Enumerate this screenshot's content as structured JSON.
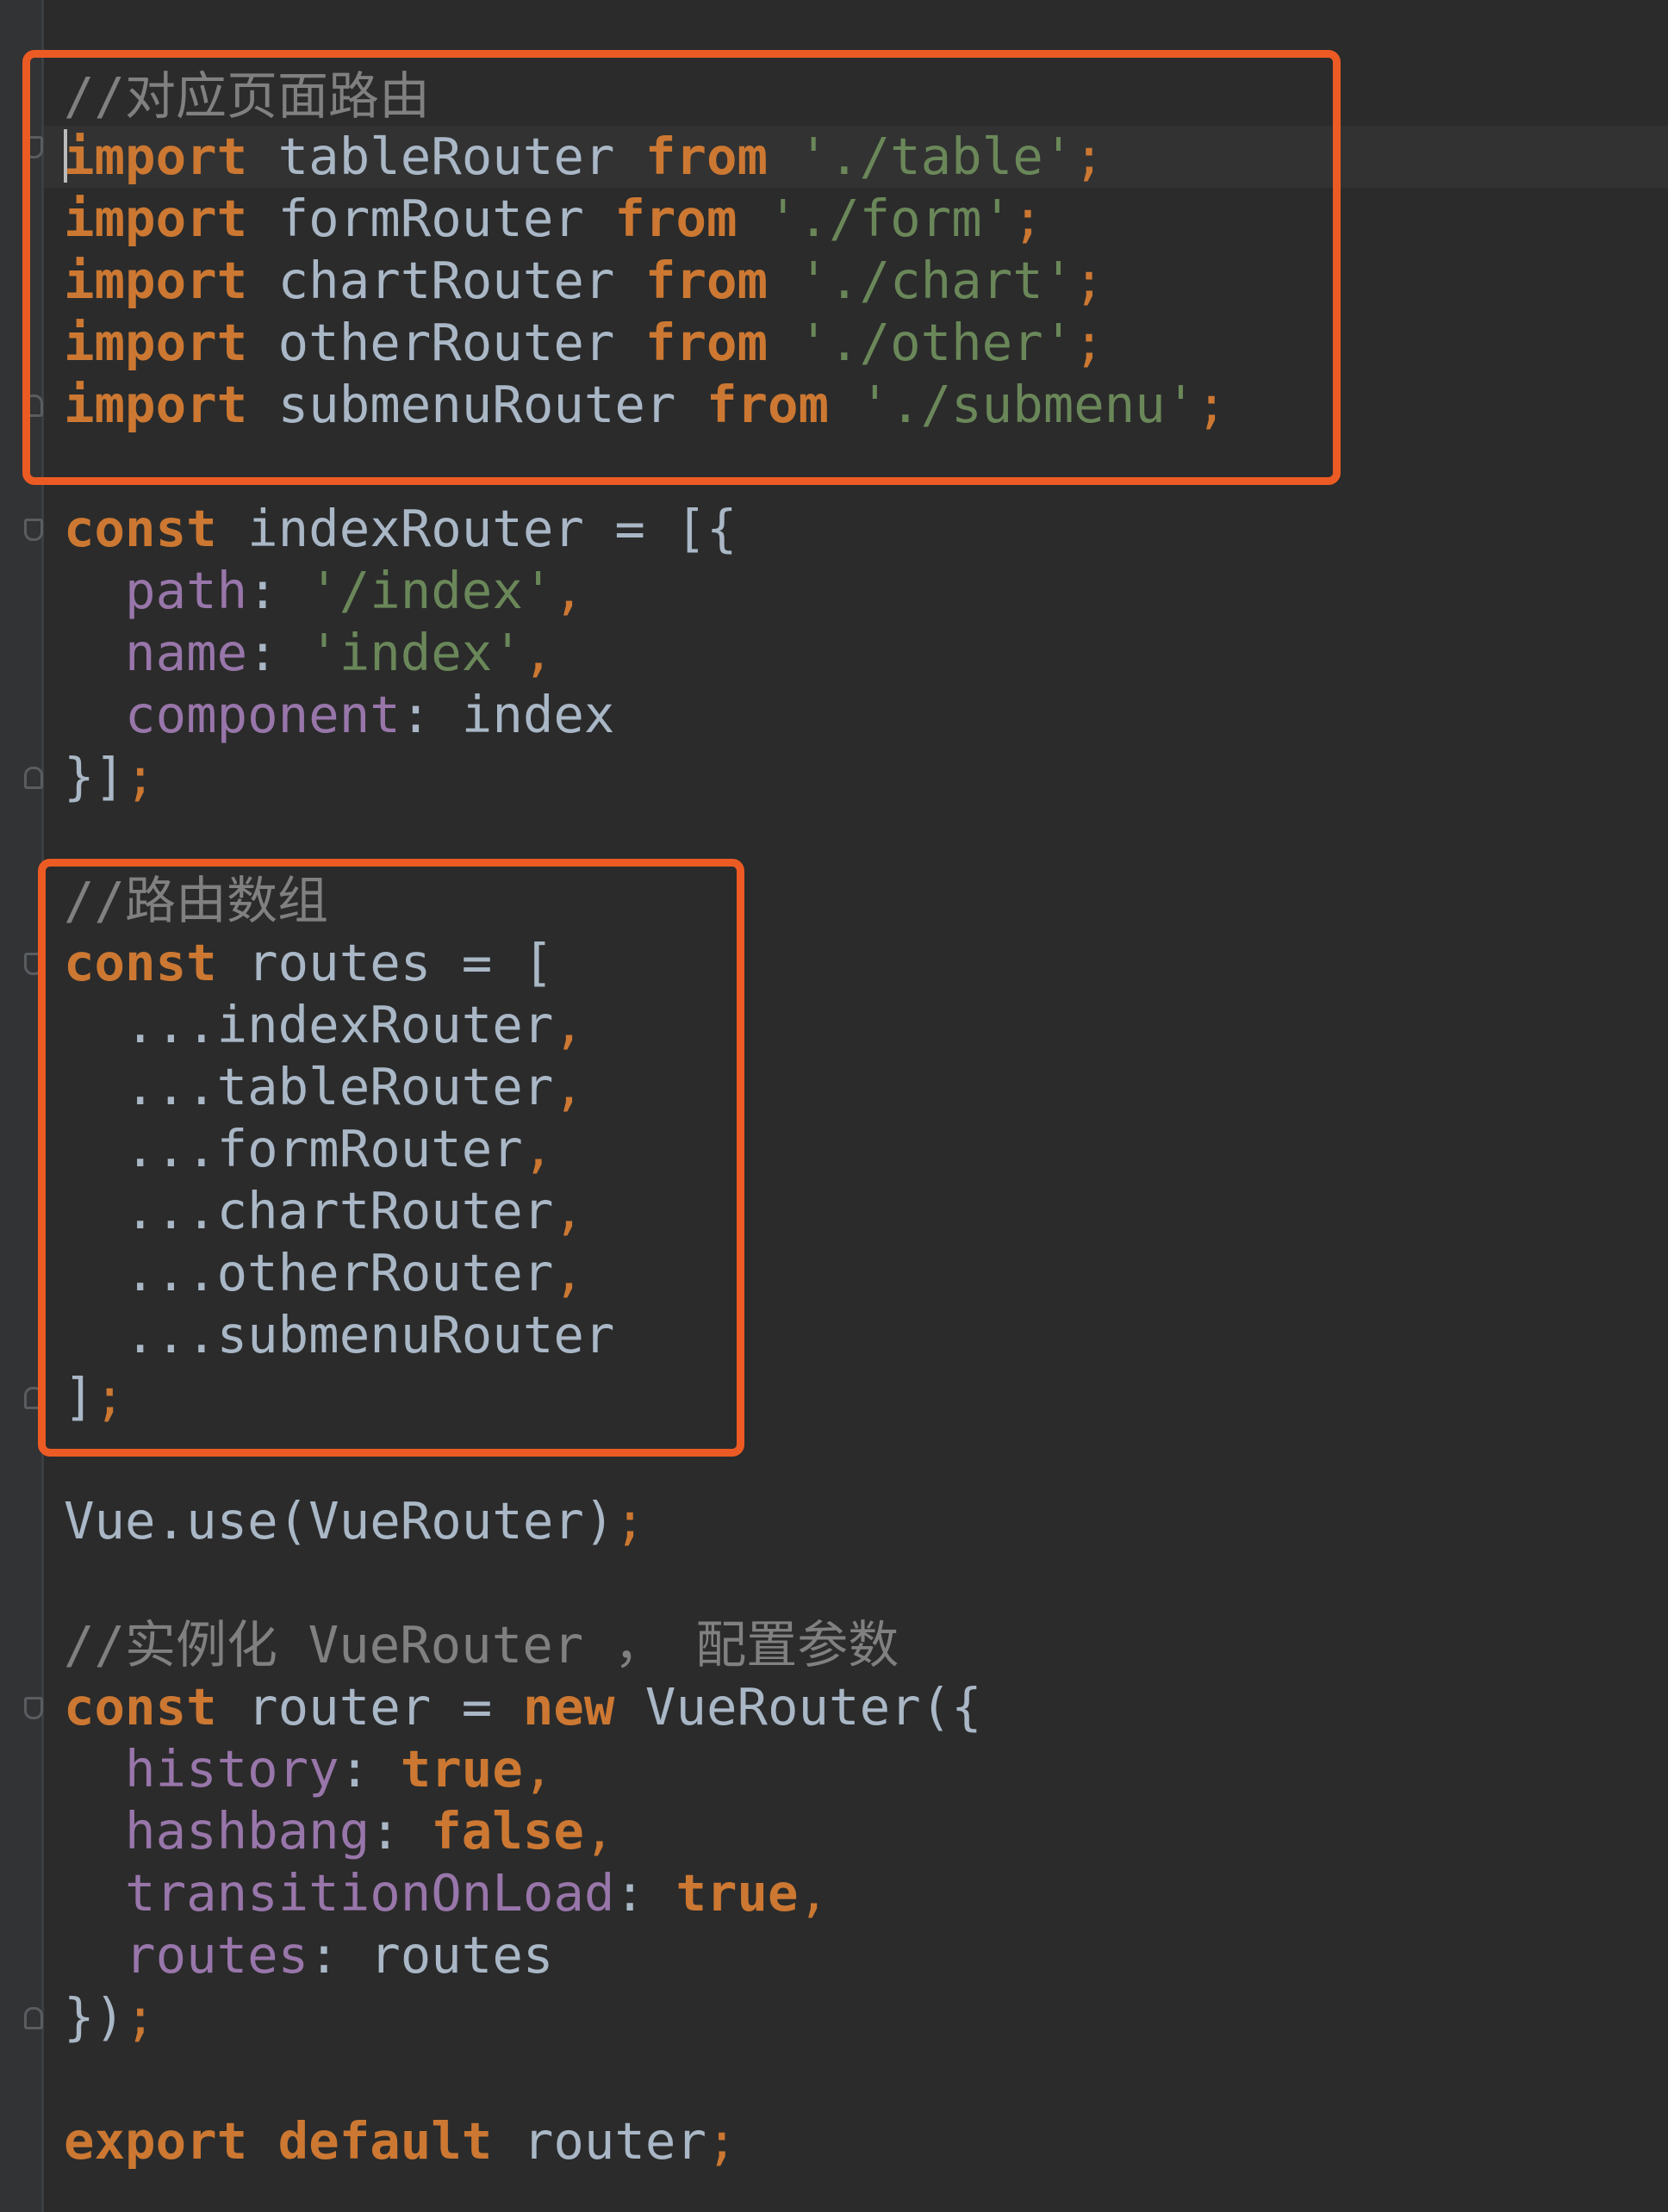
{
  "editor": {
    "colors": {
      "background": "#2b2b2b",
      "keyword": "#cc7832",
      "string": "#6a8759",
      "property": "#9876aa",
      "comment": "#808080",
      "text": "#a9b7c6",
      "highlight_box": "#ec5b24"
    },
    "lines": {
      "l1": "//对应页面路由",
      "l2": {
        "kw": "import",
        "name": " tableRouter ",
        "kw2": "from",
        "sp": " ",
        "str": "'./table'",
        "end": ";"
      },
      "l3": {
        "kw": "import",
        "name": " formRouter ",
        "kw2": "from",
        "sp": " ",
        "str": "'./form'",
        "end": ";"
      },
      "l4": {
        "kw": "import",
        "name": " chartRouter ",
        "kw2": "from",
        "sp": " ",
        "str": "'./chart'",
        "end": ";"
      },
      "l5": {
        "kw": "import",
        "name": " otherRouter ",
        "kw2": "from",
        "sp": " ",
        "str": "'./other'",
        "end": ";"
      },
      "l6": {
        "kw": "import",
        "name": " submenuRouter ",
        "kw2": "from",
        "sp": " ",
        "str": "'./submenu'",
        "end": ";"
      },
      "l7": {
        "kw": "const",
        "rest": " indexRouter = [{"
      },
      "l8": {
        "indent": "  ",
        "prop": "path",
        "colon": ": ",
        "str": "'/index'",
        "end": ","
      },
      "l9": {
        "indent": "  ",
        "prop": "name",
        "colon": ": ",
        "str": "'index'",
        "end": ","
      },
      "l10": {
        "indent": "  ",
        "prop": "component",
        "rest": ": index"
      },
      "l11": {
        "text": "}]",
        "end": ";"
      },
      "l12": "//路由数组",
      "l13": {
        "kw": "const",
        "rest": " routes = ["
      },
      "l14": {
        "text": "  ...indexRouter",
        "end": ","
      },
      "l15": {
        "text": "  ...tableRouter",
        "end": ","
      },
      "l16": {
        "text": "  ...formRouter",
        "end": ","
      },
      "l17": {
        "text": "  ...chartRouter",
        "end": ","
      },
      "l18": {
        "text": "  ...otherRouter",
        "end": ","
      },
      "l19": {
        "text": "  ...submenuRouter"
      },
      "l20": {
        "text": "]",
        "end": ";"
      },
      "l21": {
        "text": "Vue.use(VueRouter)",
        "end": ";"
      },
      "l22": "//实例化 VueRouter ， 配置参数",
      "l23": {
        "kw": "const",
        "mid": " router = ",
        "kw2": "new",
        "rest": " VueRouter({"
      },
      "l24": {
        "indent": "  ",
        "prop": "history",
        "colon": ": ",
        "val": "true",
        "end": ","
      },
      "l25": {
        "indent": "  ",
        "prop": "hashbang",
        "colon": ": ",
        "val": "false",
        "end": ","
      },
      "l26": {
        "indent": "  ",
        "prop": "transitionOnLoad",
        "colon": ": ",
        "val": "true",
        "end": ","
      },
      "l27": {
        "indent": "  ",
        "prop": "routes",
        "rest": ": routes"
      },
      "l28": {
        "text": "})",
        "end": ";"
      },
      "l29": {
        "kw": "export",
        "sp": " ",
        "kw2": "default",
        "rest": " router",
        "end": ";"
      }
    }
  }
}
